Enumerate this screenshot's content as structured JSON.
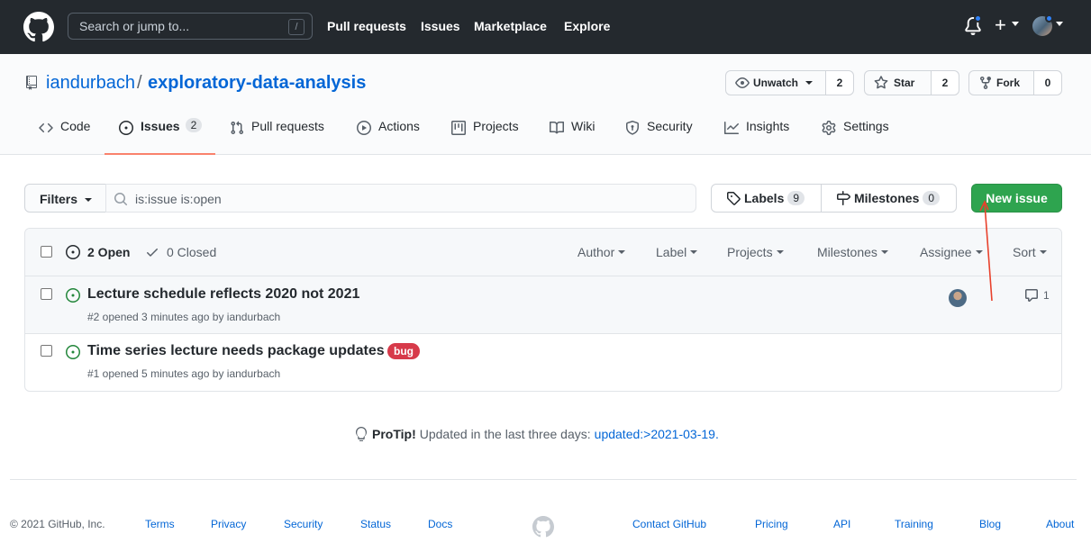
{
  "header": {
    "search_placeholder": "Search or jump to...",
    "search_shortcut": "/",
    "nav": [
      "Pull requests",
      "Issues",
      "Marketplace",
      "Explore"
    ]
  },
  "repo": {
    "owner": "iandurbach",
    "separator": "/",
    "name": "exploratory-data-analysis",
    "watch_label": "Unwatch",
    "watch_count": "2",
    "star_label": "Star",
    "star_count": "2",
    "fork_label": "Fork",
    "fork_count": "0"
  },
  "tabs": [
    {
      "label": "Code",
      "icon": "code-icon"
    },
    {
      "label": "Issues",
      "icon": "issue-icon",
      "counter": "2",
      "selected": true
    },
    {
      "label": "Pull requests",
      "icon": "pull-request-icon"
    },
    {
      "label": "Actions",
      "icon": "play-icon"
    },
    {
      "label": "Projects",
      "icon": "project-icon"
    },
    {
      "label": "Wiki",
      "icon": "book-icon"
    },
    {
      "label": "Security",
      "icon": "shield-icon"
    },
    {
      "label": "Insights",
      "icon": "graph-icon"
    },
    {
      "label": "Settings",
      "icon": "gear-icon"
    }
  ],
  "subnav": {
    "filters_label": "Filters",
    "filter_query": "is:issue is:open",
    "labels_label": "Labels",
    "labels_count": "9",
    "milestones_label": "Milestones",
    "milestones_count": "0",
    "new_issue_label": "New issue"
  },
  "issues_header": {
    "open_label": "2 Open",
    "closed_label": "0 Closed",
    "filters": [
      "Author",
      "Label",
      "Projects",
      "Milestones",
      "Assignee",
      "Sort"
    ]
  },
  "issues": [
    {
      "title": "Lecture schedule reflects 2020 not 2021",
      "meta": "#2 opened 3 minutes ago by iandurbach",
      "comments": "1",
      "has_assignee": true
    },
    {
      "title": "Time series lecture needs package updates",
      "meta": "#1 opened 5 minutes ago by iandurbach",
      "label": "bug",
      "label_color": "#d73a4a"
    }
  ],
  "protip": {
    "prefix": "ProTip!",
    "text": "Updated in the last three days:",
    "link": "updated:>2021-03-19."
  },
  "footer": {
    "copyright": "© 2021 GitHub, Inc.",
    "links": [
      "Terms",
      "Privacy",
      "Security",
      "Status",
      "Docs",
      "Contact GitHub",
      "Pricing",
      "API",
      "Training",
      "Blog",
      "About"
    ]
  },
  "colors": {
    "header_bg": "#24292e",
    "link": "#0366d6",
    "new_issue_green": "#2ea44f",
    "open_issue_green": "#22863a",
    "tab_underline": "#f9826c",
    "annotation_arrow": "#e8412c"
  }
}
